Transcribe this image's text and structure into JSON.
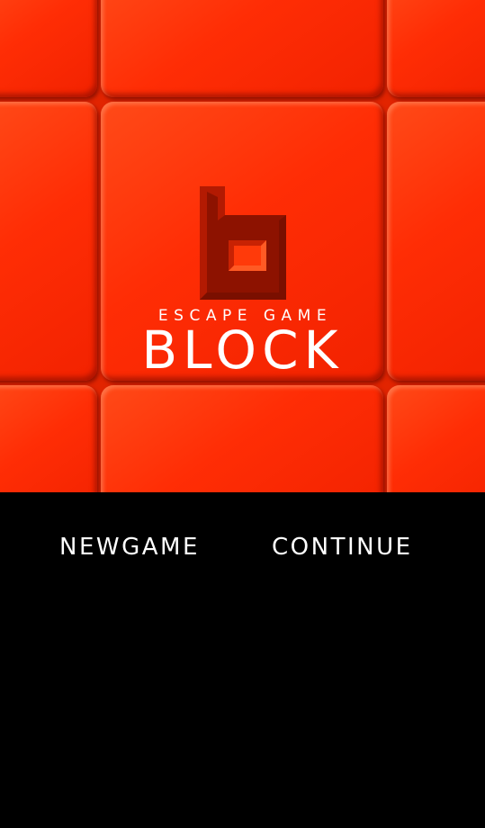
{
  "title_screen": {
    "subtitle": "ESCAPE GAME",
    "title": "BLOCK",
    "logo_icon": "block-b-logo",
    "background_color": "#ff2d05",
    "logo_color": "#a01500"
  },
  "menu": {
    "new_game_label": "NEWGAME",
    "continue_label": "CONTINUE"
  }
}
